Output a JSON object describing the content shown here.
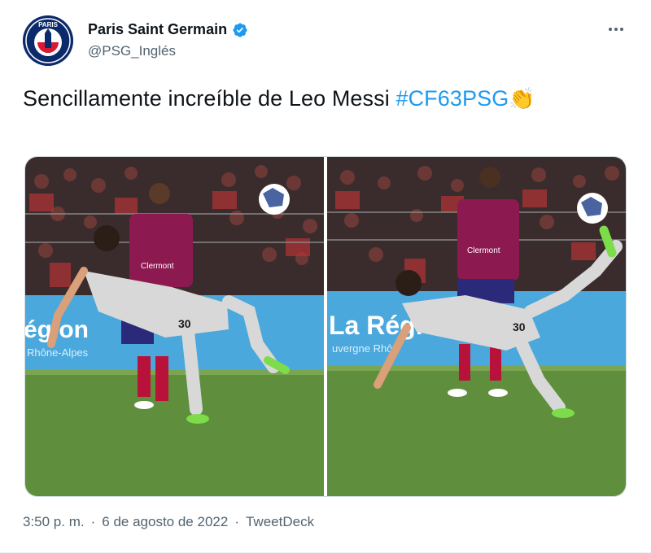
{
  "tweet": {
    "author_name": "Paris Saint Germain",
    "handle": "@PSG_Inglés",
    "avatar_text": "PARIS",
    "text": "Sencillamente increíble de Leo Messi ",
    "hashtag": "#CF63PSG",
    "emoji": "👏",
    "time": "3:50 p. m.",
    "separator": "·",
    "date": "6 de agosto de 2022",
    "source": "TweetDeck",
    "photo_texts": {
      "left": {
        "banner": "égion",
        "banner_sub": "Rhône-Alpes",
        "sponsor": "Clermont",
        "number": "30"
      },
      "right": {
        "banner": "La Régi",
        "banner_sub": "uvergne Rhô",
        "sponsor": "Clermont",
        "number": "30"
      }
    }
  },
  "colors": {
    "text": "#0f1419",
    "secondary": "#536471",
    "link": "#1d9bf0",
    "verified": "#1d9bf0",
    "psg_navy": "#0b2a6b",
    "pitch": "#5f8f3c",
    "clermont_red": "#b8123a"
  },
  "icons": {
    "verified": "verified-badge-icon",
    "more": "more-horizontal-icon",
    "avatar": "psg-crest-icon"
  }
}
